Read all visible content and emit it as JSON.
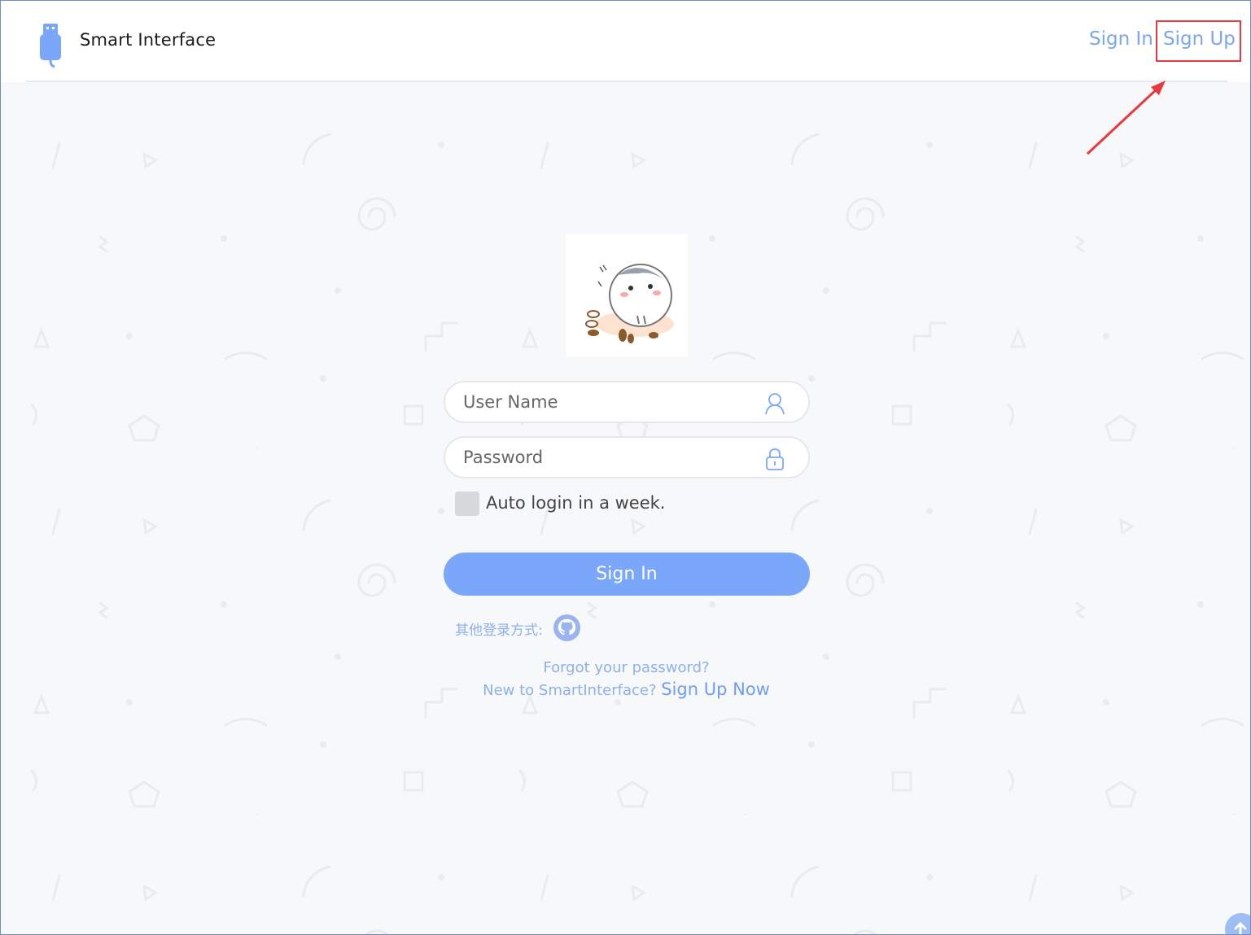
{
  "header": {
    "app_title": "Smart Interface",
    "nav": {
      "sign_in": "Sign In",
      "sign_up": "Sign Up"
    }
  },
  "login_form": {
    "username_placeholder": "User Name",
    "password_placeholder": "Password",
    "remember_label": "Auto login in a week.",
    "submit_label": "Sign In",
    "other_login_label": "其他登录方式:",
    "forgot_password": "Forgot your password?",
    "new_user_prompt": "New to SmartInterface?",
    "sign_up_now": "Sign Up Now"
  },
  "icons": [
    "usb-logo-icon",
    "user-icon",
    "lock-icon",
    "github-icon",
    "arrow-up-icon"
  ],
  "colors": {
    "accent": "#7ba7fb",
    "link": "#7ba7f0",
    "highlight": "#e8393c",
    "background": "#f7f8fa"
  }
}
